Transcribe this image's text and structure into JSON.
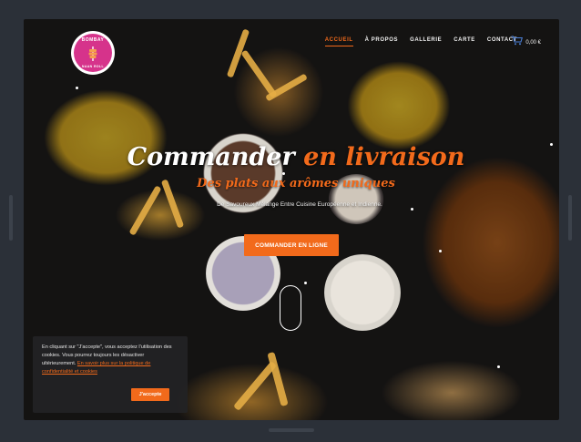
{
  "nav": {
    "items": [
      {
        "label": "ACCUEIL",
        "active": true
      },
      {
        "label": "À PROPOS",
        "active": false
      },
      {
        "label": "GALLERIE",
        "active": false
      },
      {
        "label": "CARTE",
        "active": false
      },
      {
        "label": "CONTACT",
        "active": false
      }
    ],
    "cart_total": "0,00 €",
    "cart_icon": "shopping-cart-icon"
  },
  "logo": {
    "top_text": "BOMBAY",
    "bottom_text": "NAAN ROLL"
  },
  "hero": {
    "title_white": "Commander",
    "title_accent": "en livraison",
    "subtitle": "Des plats aux arômes uniques",
    "description": "De Savoureux Mélange Entre Cuisine Européenne et Indienne.",
    "cta_label": "COMMANDER EN LIGNE"
  },
  "cookie": {
    "text": "En cliquant sur \"J'accepte\", vous acceptez l'utilisation des cookies. Vous pourrez toujours les désactiver ultérieurement.",
    "link_text": "En savoir plus sur la politique de confidentialité et cookies",
    "accept_label": "J'accepte"
  },
  "colors": {
    "accent": "#f26a1b",
    "brand_pink": "#d6338b",
    "cookie_bg": "#222224",
    "chrome_bg": "#2b3038"
  }
}
